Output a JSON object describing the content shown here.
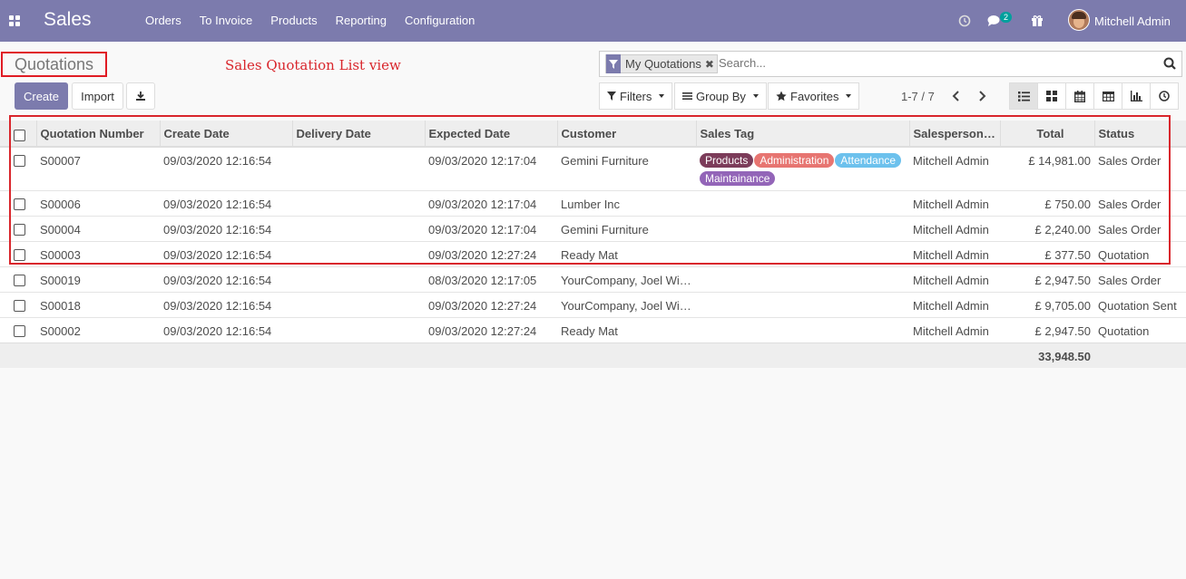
{
  "navbar": {
    "brand": "Sales",
    "menu": [
      "Orders",
      "To Invoice",
      "Products",
      "Reporting",
      "Configuration"
    ],
    "chat_count": "2",
    "user": "Mitchell Admin",
    "bg_color": "#7c7bad"
  },
  "control": {
    "title": "Quotations",
    "annotation": "Sales Quotation List view",
    "create_label": "Create",
    "import_label": "Import",
    "facet_label": "My Quotations",
    "search_placeholder": "Search...",
    "filters_label": "Filters",
    "groupby_label": "Group By",
    "favorites_label": "Favorites",
    "pager": "1-7 / 7"
  },
  "table": {
    "columns": [
      "Quotation Number",
      "Create Date",
      "Delivery Date",
      "Expected Date",
      "Customer",
      "Sales Tag",
      "Salesperson…",
      "Total",
      "Status"
    ],
    "rows": [
      {
        "number": "S00007",
        "create": "09/03/2020 12:16:54",
        "delivery": "",
        "expected": "09/03/2020 12:17:04",
        "customer": "Gemini Furniture",
        "tags": [
          {
            "label": "Products",
            "color": "#7c3c5a"
          },
          {
            "label": "Administration",
            "color": "#e77571"
          },
          {
            "label": "Attendance",
            "color": "#6cc1ed"
          },
          {
            "label": "Maintainance",
            "color": "#9365b8"
          }
        ],
        "salesperson": "Mitchell Admin",
        "total": "£ 14,981.00",
        "status": "Sales Order"
      },
      {
        "number": "S00006",
        "create": "09/03/2020 12:16:54",
        "delivery": "",
        "expected": "09/03/2020 12:17:04",
        "customer": "Lumber Inc",
        "tags": [],
        "salesperson": "Mitchell Admin",
        "total": "£ 750.00",
        "status": "Sales Order"
      },
      {
        "number": "S00004",
        "create": "09/03/2020 12:16:54",
        "delivery": "",
        "expected": "09/03/2020 12:17:04",
        "customer": "Gemini Furniture",
        "tags": [],
        "salesperson": "Mitchell Admin",
        "total": "£ 2,240.00",
        "status": "Sales Order"
      },
      {
        "number": "S00003",
        "create": "09/03/2020 12:16:54",
        "delivery": "",
        "expected": "09/03/2020 12:27:24",
        "customer": "Ready Mat",
        "tags": [],
        "salesperson": "Mitchell Admin",
        "total": "£ 377.50",
        "status": "Quotation"
      },
      {
        "number": "S00019",
        "create": "09/03/2020 12:16:54",
        "delivery": "",
        "expected": "08/03/2020 12:17:05",
        "customer": "YourCompany, Joel Wi…",
        "tags": [],
        "salesperson": "Mitchell Admin",
        "total": "£ 2,947.50",
        "status": "Sales Order"
      },
      {
        "number": "S00018",
        "create": "09/03/2020 12:16:54",
        "delivery": "",
        "expected": "09/03/2020 12:27:24",
        "customer": "YourCompany, Joel Wi…",
        "tags": [],
        "salesperson": "Mitchell Admin",
        "total": "£ 9,705.00",
        "status": "Quotation Sent"
      },
      {
        "number": "S00002",
        "create": "09/03/2020 12:16:54",
        "delivery": "",
        "expected": "09/03/2020 12:27:24",
        "customer": "Ready Mat",
        "tags": [],
        "salesperson": "Mitchell Admin",
        "total": "£ 2,947.50",
        "status": "Quotation"
      }
    ],
    "sum_total": "33,948.50"
  }
}
